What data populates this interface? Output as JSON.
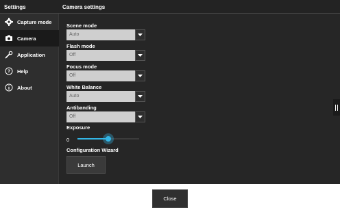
{
  "sidebar": {
    "title": "Settings",
    "items": [
      {
        "label": "Capture mode",
        "icon": "gear-icon"
      },
      {
        "label": "Camera",
        "icon": "camera-icon"
      },
      {
        "label": "Application",
        "icon": "wrench-icon"
      },
      {
        "label": "Help",
        "icon": "help-icon"
      },
      {
        "label": "About",
        "icon": "info-icon"
      }
    ],
    "active_index": 1
  },
  "main": {
    "title": "Camera settings",
    "scene_mode": {
      "label": "Scene mode",
      "value": "Auto"
    },
    "flash_mode": {
      "label": "Flash mode",
      "value": "Off"
    },
    "focus_mode": {
      "label": "Focus mode",
      "value": "Off"
    },
    "white_balance": {
      "label": "White Balance",
      "value": "Auto"
    },
    "antibanding": {
      "label": "Antibanding",
      "value": "Off"
    },
    "exposure": {
      "label": "Exposure",
      "value": "0",
      "slider_fraction": 0.5
    },
    "config_wizard": {
      "label": "Configuration Wizard",
      "button": "Launch"
    }
  },
  "footer": {
    "close_label": "Close"
  },
  "colors": {
    "accent": "#33b5e5",
    "background": "#262626",
    "sidebar_active": "#1a1a1a"
  }
}
